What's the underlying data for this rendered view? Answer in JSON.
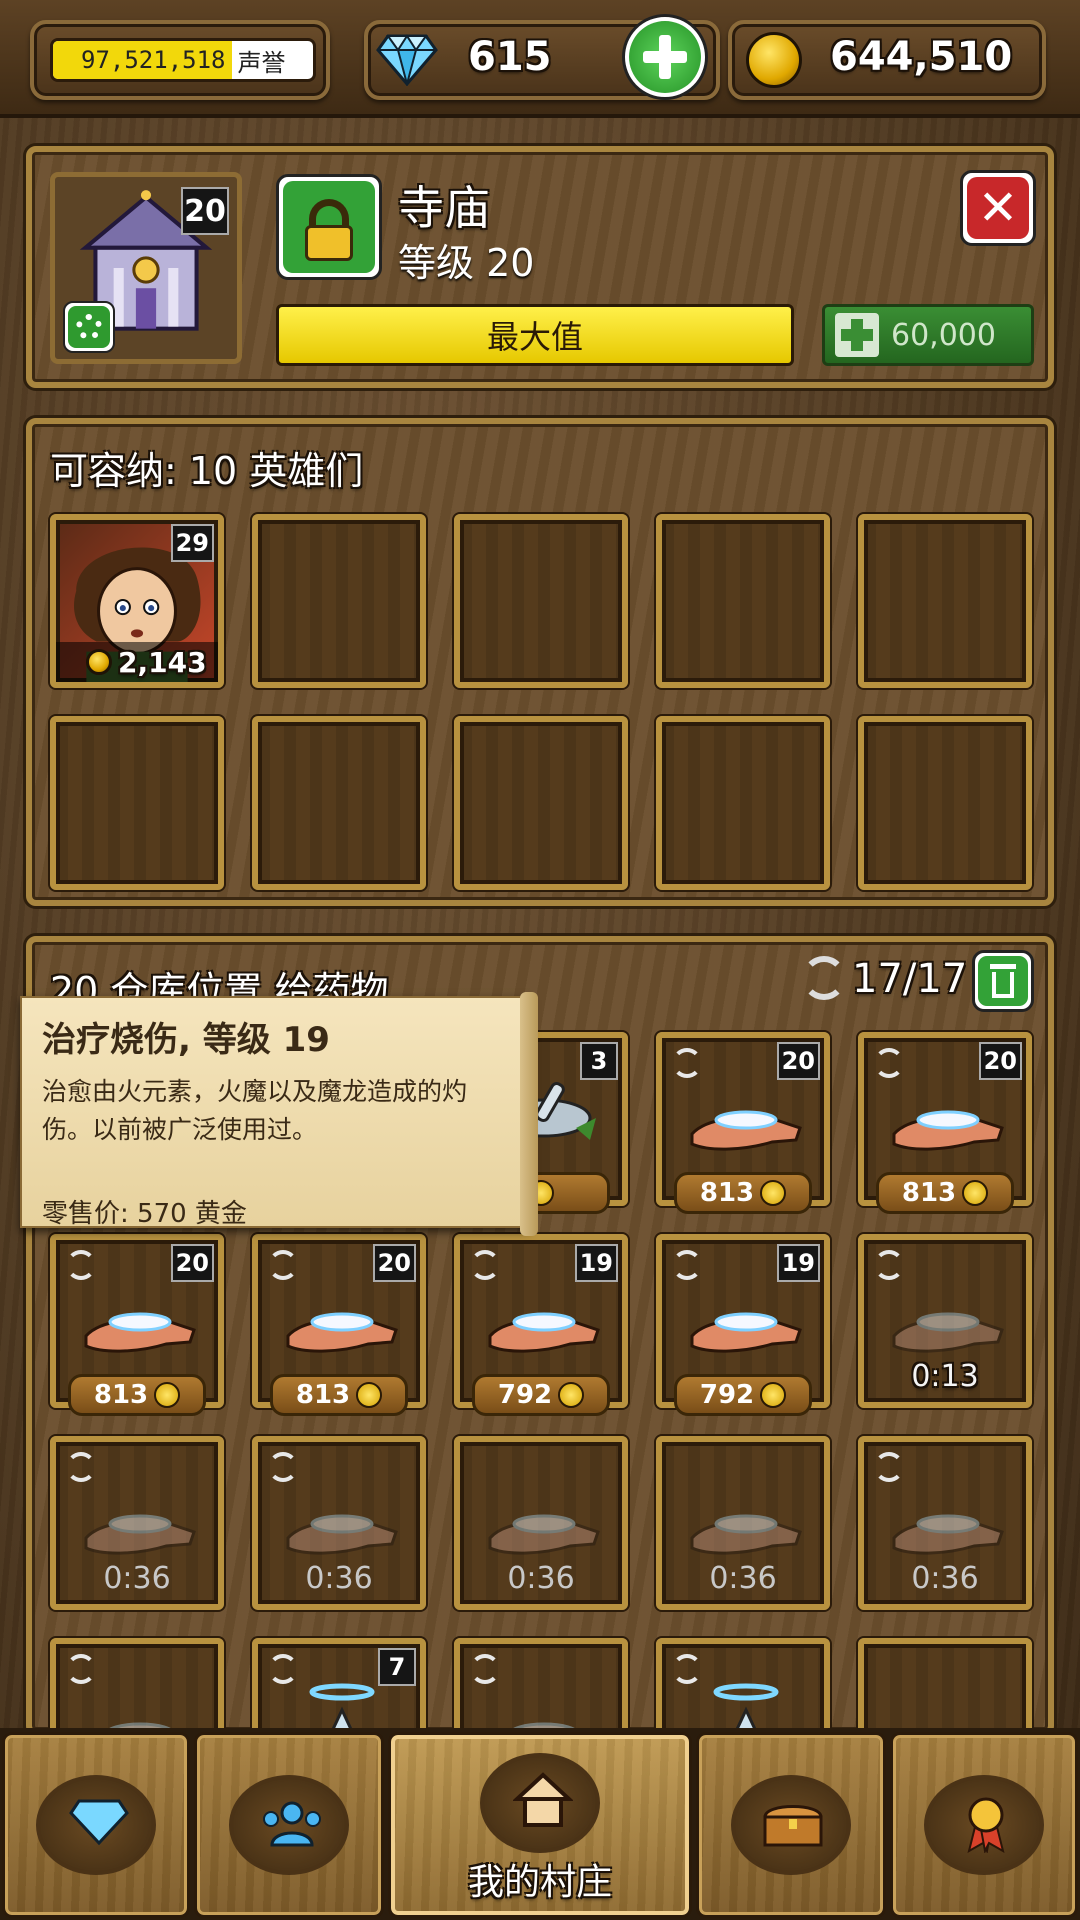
{
  "top_bar": {
    "reputation_value": "97,521,518",
    "reputation_label": "声誉",
    "gems": "615",
    "gold": "644,510"
  },
  "building": {
    "level_badge": "20",
    "name": "寺庙",
    "level_text": "等级 20",
    "progress_label": "最大值",
    "upgrade_cost": "60,000"
  },
  "heroes": {
    "title": "可容纳: 10 英雄们",
    "slots": [
      {
        "level": "29",
        "price": "2,143"
      }
    ]
  },
  "storage": {
    "title": "20 仓库位置 给药物",
    "count": "17/17",
    "row1": [
      {
        "level": "3",
        "price": ""
      },
      {
        "level": "20",
        "price": "813"
      },
      {
        "level": "20",
        "price": "813"
      }
    ],
    "row2": [
      {
        "level": "20",
        "price": "813"
      },
      {
        "level": "20",
        "price": "813"
      },
      {
        "level": "19",
        "price": "792"
      },
      {
        "level": "19",
        "price": "792"
      },
      {
        "timer": "0:13"
      }
    ],
    "row3_timers": [
      "0:36",
      "0:36",
      "0:36",
      "0:36",
      "0:36"
    ],
    "row4_levels": [
      "7"
    ]
  },
  "tooltip": {
    "title": "治疗烧伤, 等级 19",
    "description": "治愈由火元素，火魔以及魔龙造成的灼伤。以前被广泛使用过。",
    "price": "零售价: 570 黄金"
  },
  "nav": {
    "home_label": "我的村庄"
  },
  "colors": {
    "accent_yellow": "#f2d80b",
    "green_button": "#2f9a2f",
    "red_close": "#c8282a",
    "wood_frame": "#b8923f"
  }
}
